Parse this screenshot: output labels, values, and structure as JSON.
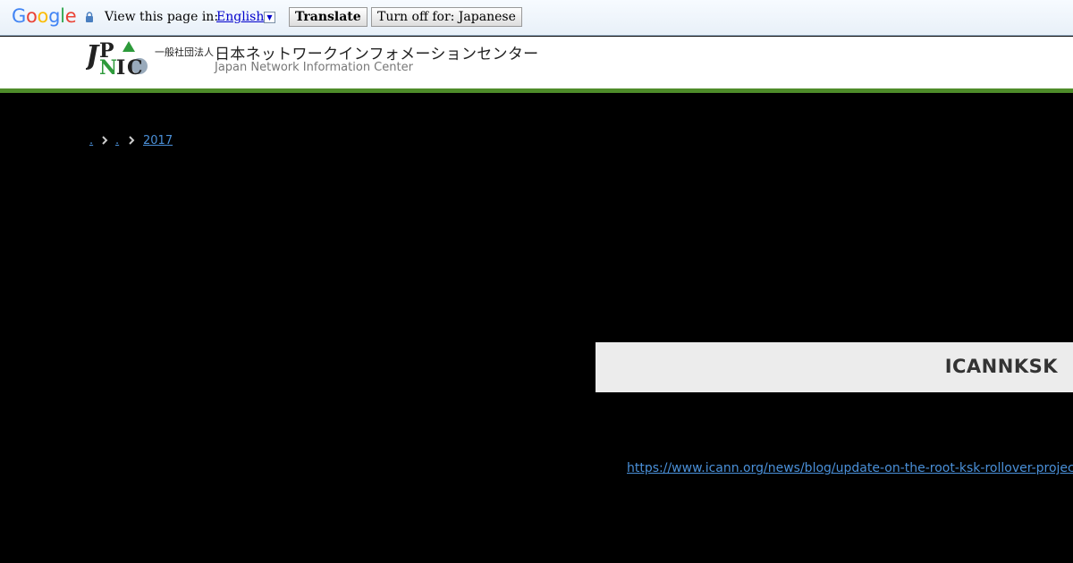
{
  "translate_bar": {
    "logo_text": "Google",
    "prompt": "View this page in:",
    "language": "English",
    "dropdown_arrow": "▼",
    "translate_button": "Translate",
    "turn_off_button": "Turn off for: Japanese"
  },
  "header": {
    "org_type": "一般社団法人",
    "org_name_ja": "日本ネットワークインフォメーションセンター",
    "org_name_en": "Japan Network Information Center",
    "logo_letters": [
      "J",
      "P",
      "N",
      "I",
      "C"
    ]
  },
  "breadcrumb": {
    "items": [
      ".",
      ".",
      "2017"
    ],
    "separator_icon": "chevron-right-icon"
  },
  "article": {
    "title": "ICANNKSK",
    "link": "https://www.icann.org/news/blog/update-on-the-root-ksk-rollover-project"
  },
  "colors": {
    "header_stripe": "#4e8c2a",
    "page_background": "#000000",
    "link": "#4a90d9",
    "title_background": "#ececec"
  }
}
